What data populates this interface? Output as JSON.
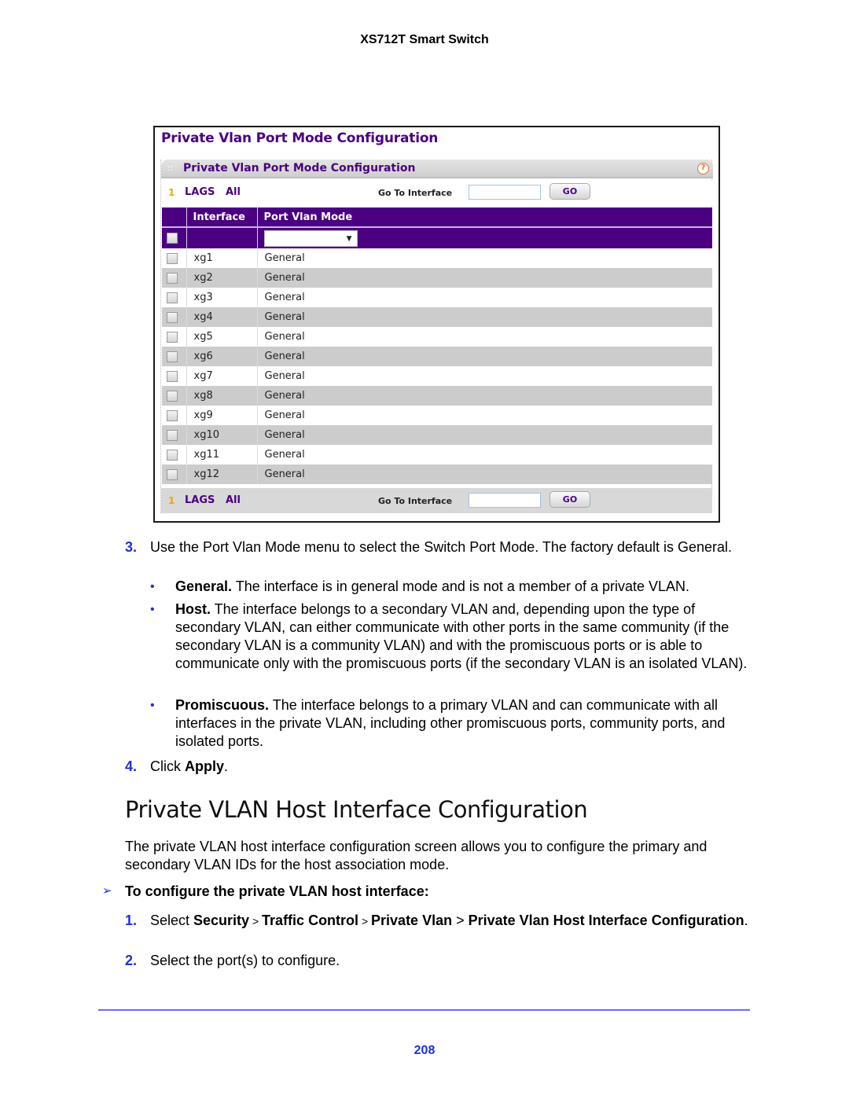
{
  "running_header": "XS712T Smart Switch",
  "screenshot": {
    "page_title": "Private Vlan Port Mode Configuration",
    "panel_title": "Private Vlan Port Mode Configuration",
    "help_icon": "?",
    "nav": {
      "unit": "1",
      "lags": "LAGS",
      "all": "All",
      "goto_label": "Go To Interface",
      "goto_value": "",
      "go_button": "GO"
    },
    "columns": [
      "Interface",
      "Port Vlan Mode"
    ],
    "mode_select_value": "",
    "rows": [
      {
        "interface": "xg1",
        "mode": "General"
      },
      {
        "interface": "xg2",
        "mode": "General"
      },
      {
        "interface": "xg3",
        "mode": "General"
      },
      {
        "interface": "xg4",
        "mode": "General"
      },
      {
        "interface": "xg5",
        "mode": "General"
      },
      {
        "interface": "xg6",
        "mode": "General"
      },
      {
        "interface": "xg7",
        "mode": "General"
      },
      {
        "interface": "xg8",
        "mode": "General"
      },
      {
        "interface": "xg9",
        "mode": "General"
      },
      {
        "interface": "xg10",
        "mode": "General"
      },
      {
        "interface": "xg11",
        "mode": "General"
      },
      {
        "interface": "xg12",
        "mode": "General"
      }
    ]
  },
  "steps_a": {
    "step3": {
      "num": "3.",
      "text": "Use the Port Vlan Mode menu to select the Switch Port Mode. The factory default is General."
    },
    "bullets": [
      {
        "term": "General.",
        "text": " The interface is in general mode and is not a member of a private VLAN."
      },
      {
        "term": "Host.",
        "text": " The interface belongs to a secondary VLAN and, depending upon the type of secondary VLAN, can either communicate with other ports in the same community (if the secondary VLAN is a community VLAN) and with the promiscuous ports or is able to communicate only with the promiscuous ports (if the secondary VLAN is an isolated VLAN)."
      },
      {
        "term": "Promiscuous.",
        "text": " The interface belongs to a primary VLAN and can communicate with all interfaces in the private VLAN, including other promiscuous ports, community ports, and isolated ports."
      }
    ],
    "step4": {
      "num": "4.",
      "pre": "Click ",
      "bold": "Apply",
      "post": "."
    }
  },
  "section": {
    "title": "Private VLAN Host Interface Configuration",
    "intro": "The private VLAN host interface configuration screen allows you to configure the primary and secondary VLAN IDs for the host association mode.",
    "procedure_icon": "arrow-right-icon",
    "procedure_title": "To configure the private VLAN host interface:",
    "step1": {
      "num": "1.",
      "pre": "Select ",
      "path": [
        "Security",
        "Traffic Control",
        "Private Vlan",
        "Private Vlan Host Interface Configuration"
      ],
      "separators": [
        " > ",
        " > ",
        " > "
      ],
      "post": "."
    },
    "step2": {
      "num": "2.",
      "text": "Select the port(s) to configure."
    }
  },
  "page_number": "208",
  "colors": {
    "accent_purple": "#4b0082",
    "doc_blue": "#1f2fd8",
    "row_alt": "#cccccc"
  }
}
